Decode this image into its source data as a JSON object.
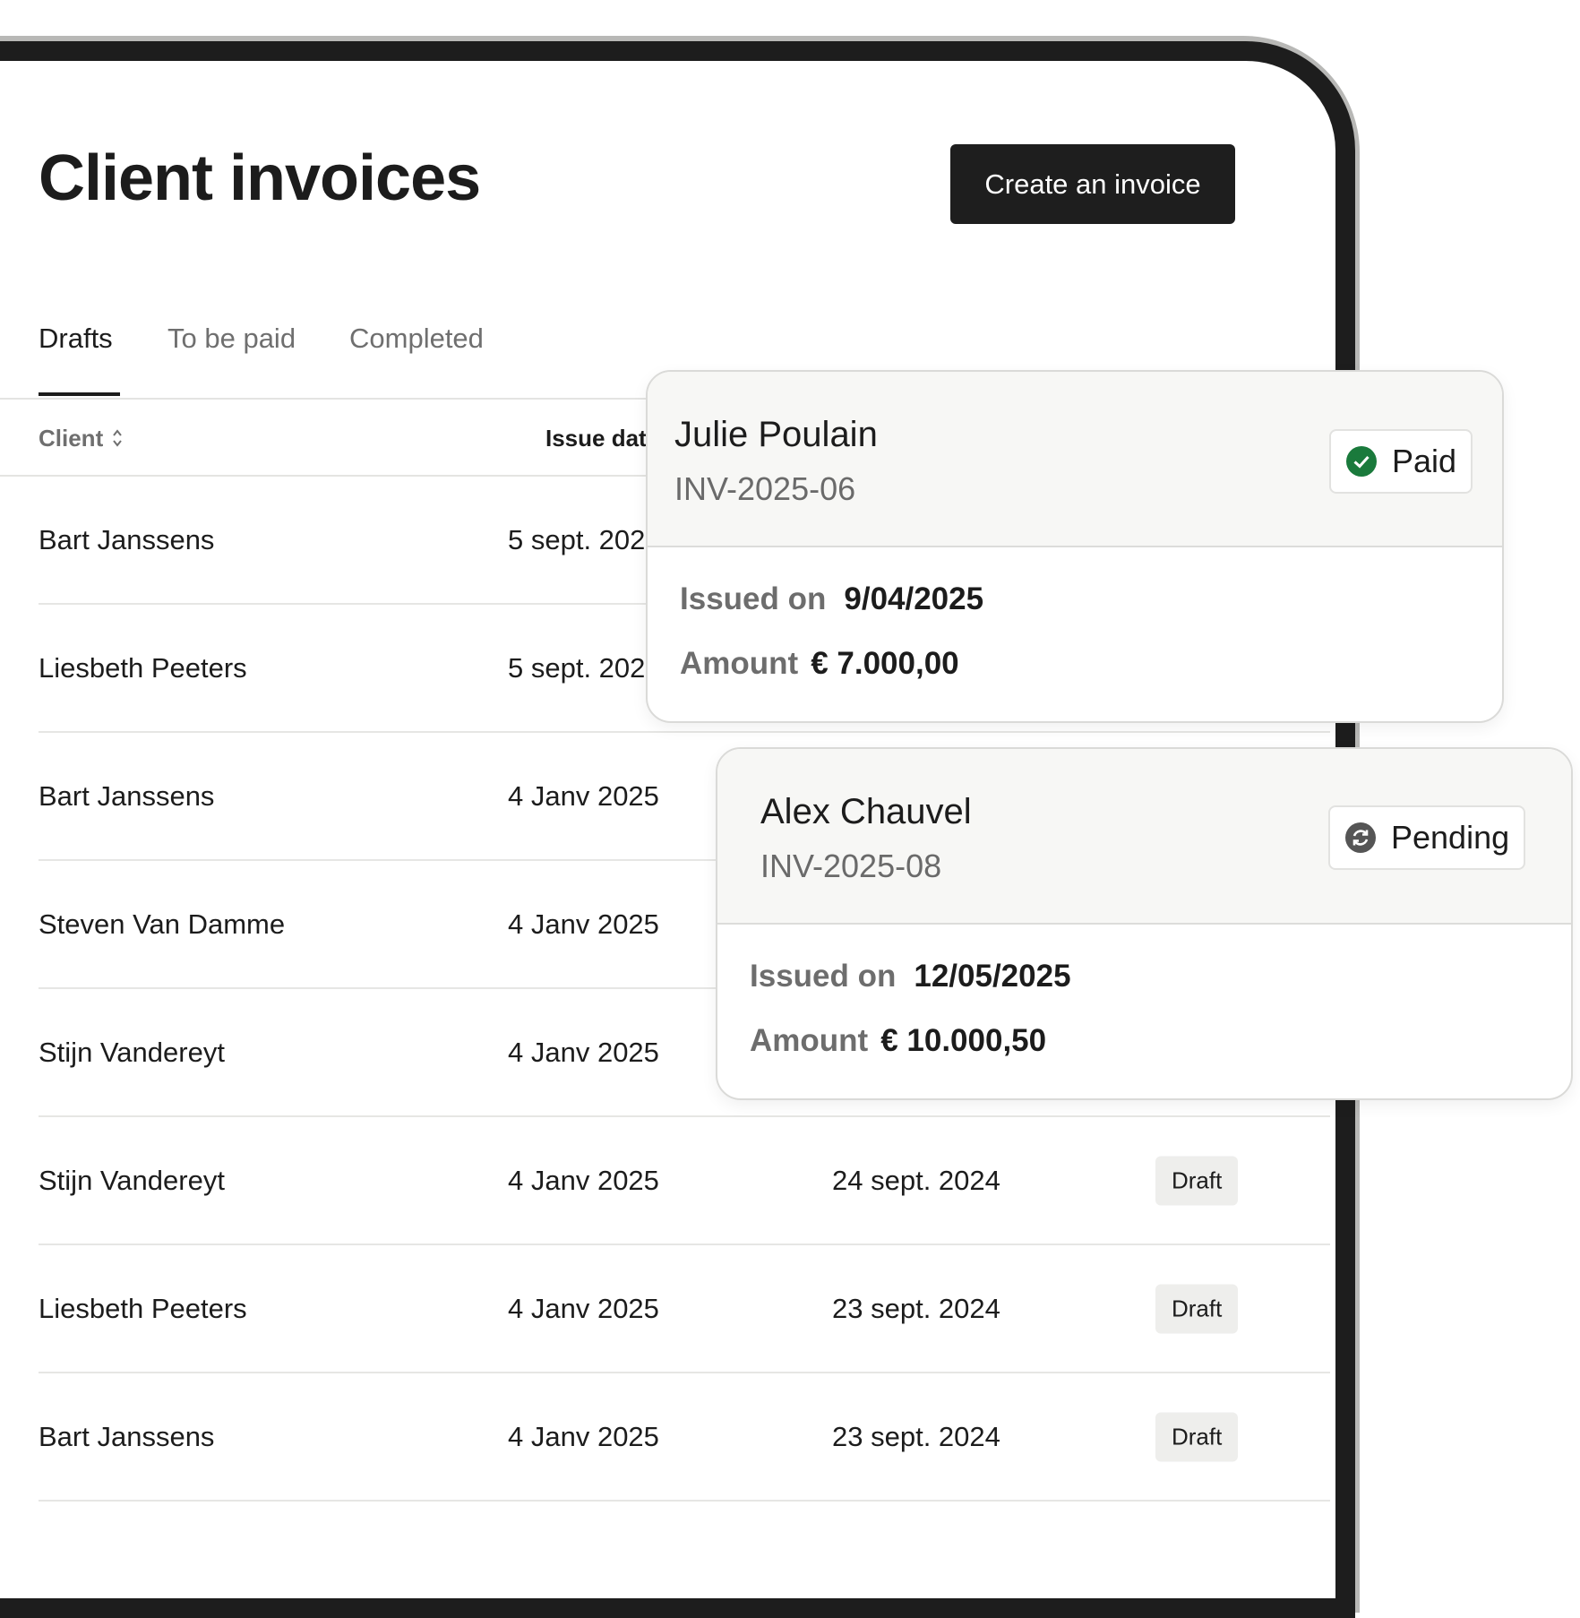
{
  "header": {
    "title": "Client invoices",
    "create_label": "Create an invoice"
  },
  "tabs": [
    {
      "label": "Drafts",
      "active": true
    },
    {
      "label": "To be paid",
      "active": false
    },
    {
      "label": "Completed",
      "active": false
    }
  ],
  "table": {
    "columns": {
      "client": "Client",
      "issue": "Issue dat"
    },
    "rows": [
      {
        "client": "Bart Janssens",
        "issue": "5 sept. 202",
        "due": "",
        "status": ""
      },
      {
        "client": "Liesbeth Peeters",
        "issue": "5 sept. 202",
        "due": "",
        "status": ""
      },
      {
        "client": "Bart Janssens",
        "issue": "4 Janv 2025",
        "due": "",
        "status": ""
      },
      {
        "client": "Steven Van Damme",
        "issue": "4 Janv 2025",
        "due": "",
        "status": ""
      },
      {
        "client": "Stijn Vandereyt",
        "issue": "4 Janv 2025",
        "due": "",
        "status": ""
      },
      {
        "client": "Stijn Vandereyt",
        "issue": "4 Janv 2025",
        "due": "24 sept. 2024",
        "status": "Draft"
      },
      {
        "client": "Liesbeth Peeters",
        "issue": "4 Janv 2025",
        "due": "23 sept. 2024",
        "status": "Draft"
      },
      {
        "client": "Bart Janssens",
        "issue": "4 Janv 2025",
        "due": "23 sept. 2024",
        "status": "Draft"
      }
    ]
  },
  "cards": [
    {
      "name": "Julie Poulain",
      "invoice": "INV-2025-06",
      "status": "Paid",
      "status_icon": "check-circle-icon",
      "status_color": "#1a7a3c",
      "issued_label": "Issued on",
      "issued_value": "9/04/2025",
      "amount_label": "Amount",
      "amount_value": "€ 7.000,00"
    },
    {
      "name": "Alex Chauvel",
      "invoice": "INV-2025-08",
      "status": "Pending",
      "status_icon": "refresh-circle-icon",
      "status_color": "#555555",
      "issued_label": "Issued on",
      "issued_value": "12/05/2025",
      "amount_label": "Amount",
      "amount_value": "€ 10.000,50"
    }
  ]
}
